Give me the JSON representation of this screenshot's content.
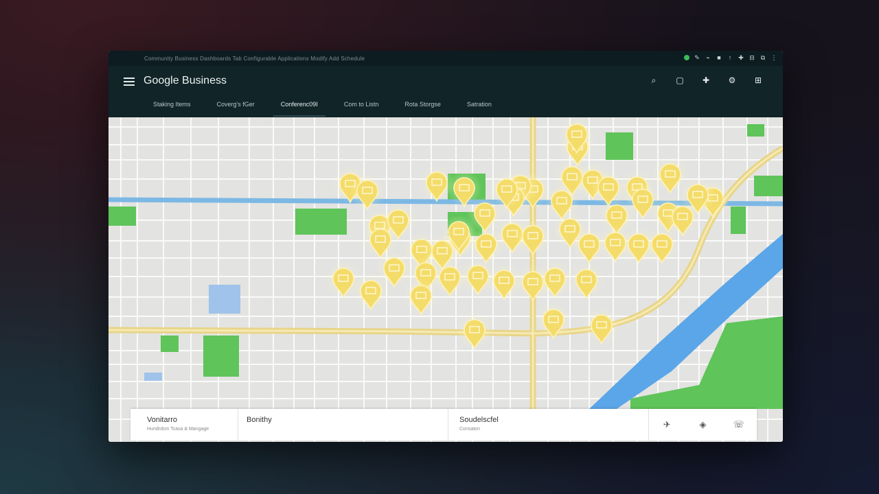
{
  "system_bar": {
    "path_text": "Community Business   Dashboards Tab   Configurable   Applications   Modify   Add   Schedule",
    "icons": [
      "status-dot",
      "pen-icon",
      "clip-icon",
      "square-icon",
      "arrow-icon",
      "puzzle-icon",
      "grid-icon",
      "copy-icon",
      "more-icon"
    ]
  },
  "app": {
    "title": "Google Business",
    "accent_color": "#112428"
  },
  "tabs": [
    {
      "label": "Staking Items"
    },
    {
      "label": "Coverg's fGer"
    },
    {
      "label": "Conferenc09I"
    },
    {
      "label": "Com to Listn"
    },
    {
      "label": "Rota Storgse"
    },
    {
      "label": "Satration"
    }
  ],
  "actions": [
    {
      "name": "search",
      "glyph": "⌕"
    },
    {
      "name": "comment",
      "glyph": "▢"
    },
    {
      "name": "add",
      "glyph": "✚"
    },
    {
      "name": "settings",
      "glyph": "⚙"
    },
    {
      "name": "apps",
      "glyph": "⊞"
    }
  ],
  "map": {
    "marker_color": "#f4dc6a",
    "marker_count": 52,
    "water_color": "#5aa6e8",
    "park_color": "#5fc45a"
  },
  "panel": {
    "col1": {
      "title": "Vonitarro",
      "subtitle": "Hundrdsm Tcasa & Mangage"
    },
    "col2": {
      "title": "Bonithy"
    },
    "col3": {
      "title": "Soudelscfel",
      "subtitle": "Consaton"
    },
    "buttons": [
      {
        "name": "directions",
        "glyph": "✈"
      },
      {
        "name": "navigate",
        "glyph": "◈"
      },
      {
        "name": "save",
        "glyph": "☏"
      }
    ]
  }
}
